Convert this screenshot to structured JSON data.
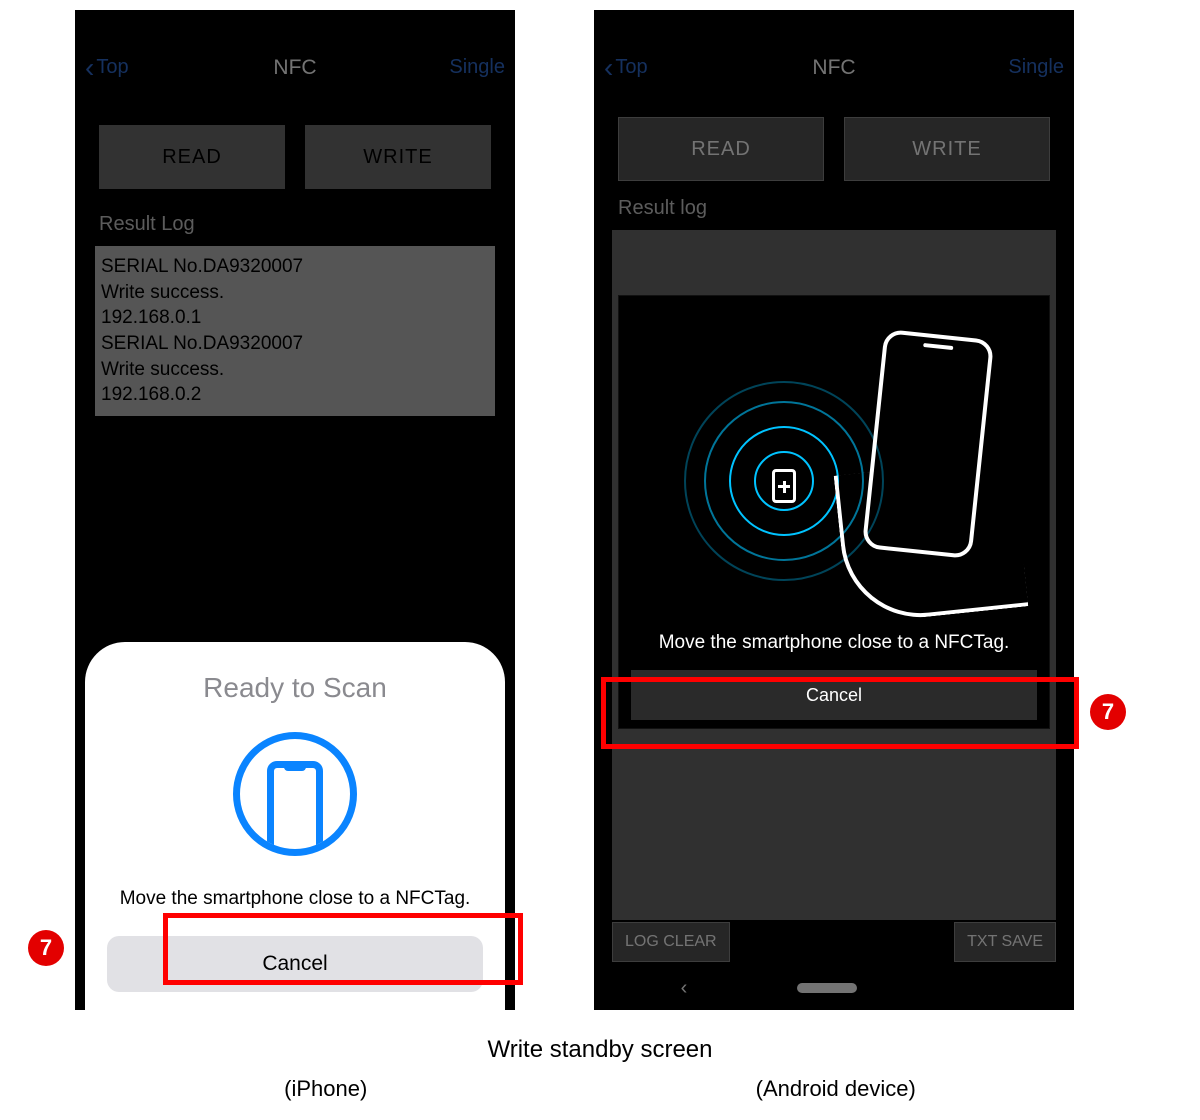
{
  "callout": {
    "number": "7"
  },
  "caption": {
    "main": "Write standby screen",
    "iphone": "(iPhone)",
    "android": "(Android device)"
  },
  "header": {
    "back": "Top",
    "title": "NFC",
    "right": "Single"
  },
  "buttons": {
    "read": "READ",
    "write": "WRITE",
    "log_clear": "LOG CLEAR",
    "txt_save": "TXT SAVE"
  },
  "iphone": {
    "result_label": "Result Log",
    "log_lines": [
      "SERIAL No.DA9320007",
      "Write success.",
      "192.168.0.1",
      "",
      "SERIAL No.DA9320007",
      "Write success.",
      "192.168.0.2"
    ],
    "sheet": {
      "title": "Ready to Scan",
      "message": "Move the smartphone close to a NFCTag.",
      "cancel": "Cancel"
    }
  },
  "android": {
    "result_label": "Result log",
    "modal": {
      "message": "Move the smartphone close to a NFCTag.",
      "cancel": "Cancel"
    }
  }
}
